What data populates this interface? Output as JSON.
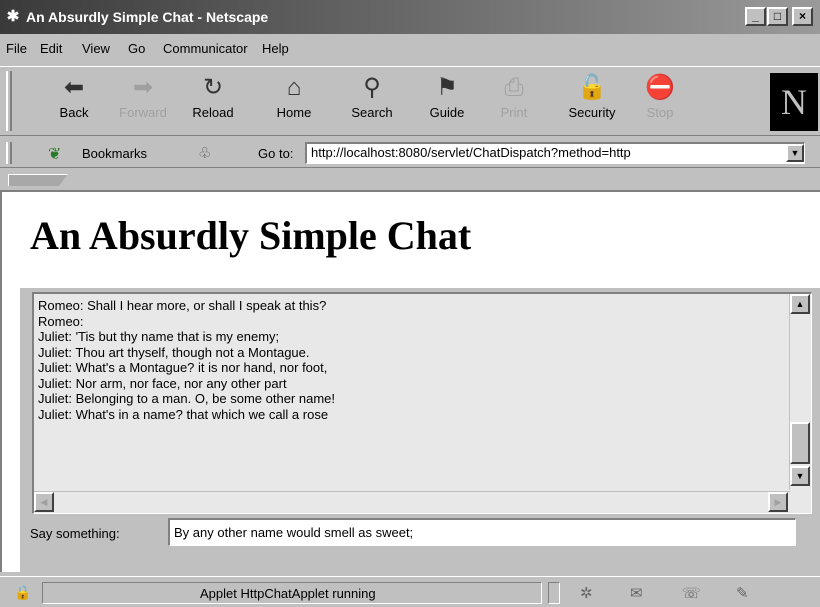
{
  "window": {
    "title": "An Absurdly Simple Chat - Netscape",
    "icon": "netscape-app-icon",
    "controls": [
      "_",
      "□",
      "×"
    ]
  },
  "menu": [
    {
      "label": "File",
      "ul": "F"
    },
    {
      "label": "Edit",
      "ul": "E"
    },
    {
      "label": "View",
      "ul": "V"
    },
    {
      "label": "Go",
      "ul": "G"
    },
    {
      "label": "Communicator",
      "ul": "C"
    },
    {
      "label": "Help",
      "ul": "H"
    }
  ],
  "toolbar": {
    "buttons": [
      {
        "label": "Back",
        "icon": "back-arrow-icon",
        "glyph": "⬅",
        "enabled": true
      },
      {
        "label": "Forward",
        "icon": "forward-arrow-icon",
        "glyph": "➡",
        "enabled": false
      },
      {
        "label": "Reload",
        "icon": "reload-icon",
        "glyph": "↻",
        "enabled": true
      },
      {
        "label": "Home",
        "icon": "home-icon",
        "glyph": "⌂",
        "enabled": true
      },
      {
        "label": "Search",
        "icon": "search-icon",
        "glyph": "⚲",
        "enabled": true
      },
      {
        "label": "Guide",
        "icon": "guide-icon",
        "glyph": "⚑",
        "enabled": true
      },
      {
        "label": "Print",
        "icon": "print-icon",
        "glyph": "⎙",
        "enabled": false
      },
      {
        "label": "Security",
        "icon": "security-lock-icon",
        "glyph": "🔓",
        "enabled": true
      },
      {
        "label": "Stop",
        "icon": "stop-icon",
        "glyph": "⛔",
        "enabled": false
      }
    ],
    "logo": "N"
  },
  "location": {
    "bookmarks_label": "Bookmarks",
    "goto_label": "Go to:",
    "url": "http://localhost:8080/servlet/ChatDispatch?method=http"
  },
  "page": {
    "heading": "An Absurdly Simple Chat",
    "chat_lines": [
      "Romeo: Shall I hear more, or shall I speak at this?",
      "Romeo:",
      "Juliet: 'Tis but thy name that is my enemy;",
      "Juliet: Thou art thyself, though not a Montague.",
      "Juliet: What's a Montague? it is nor hand, nor foot,",
      "Juliet: Nor arm, nor face, nor any other part",
      "Juliet: Belonging to a man. O, be some other name!",
      "Juliet: What's in a name? that which we call a rose"
    ],
    "say_label": "Say something:",
    "say_value": "By any other name would smell as sweet;"
  },
  "status": {
    "text": "Applet HttpChatApplet running"
  }
}
